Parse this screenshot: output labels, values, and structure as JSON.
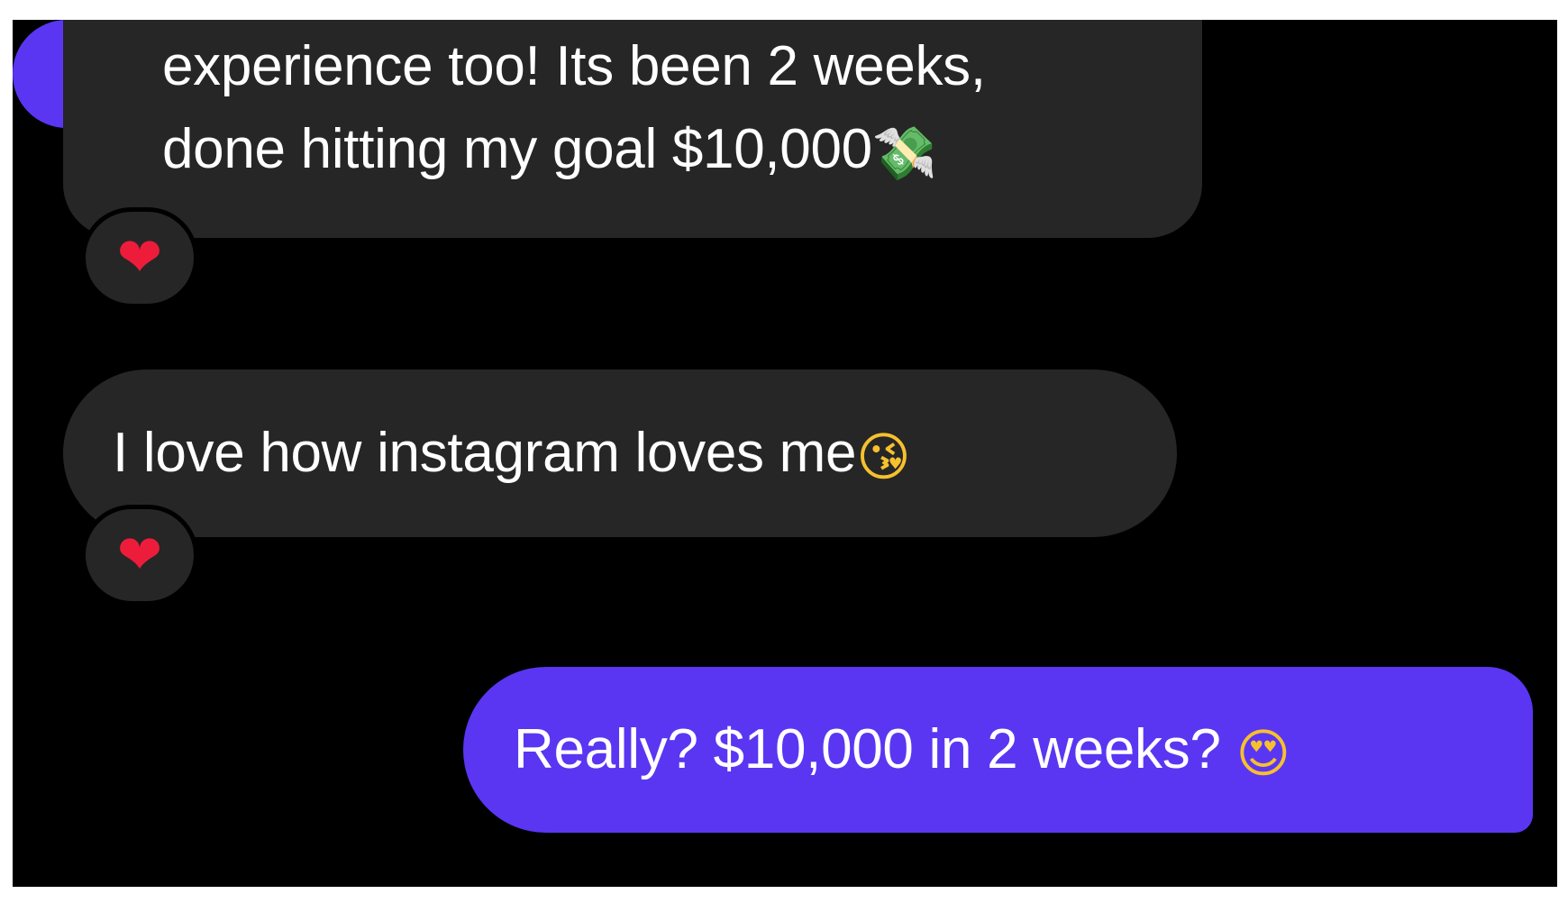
{
  "conversation": {
    "messages": [
      {
        "direction": "incoming",
        "lines": [
          "experience too! Its been 2 weeks,",
          "done hitting my goal $10,000"
        ],
        "emoji": "💸",
        "emoji_name": "money-with-wings-icon",
        "reaction": "❤"
      },
      {
        "direction": "incoming",
        "text": "I love how instagram loves me",
        "emoji": "😘",
        "emoji_name": "face-blowing-kiss-icon",
        "reaction": "❤"
      },
      {
        "direction": "outgoing",
        "text": "Really? $10,000 in 2 weeks?",
        "emoji": "😍",
        "emoji_name": "heart-eyes-icon"
      }
    ]
  },
  "colors": {
    "background": "#000000",
    "incoming_bubble": "#262626",
    "outgoing_bubble": "#5a36f2",
    "text": "#ffffff",
    "reaction_heart": "#ee1c3b"
  }
}
